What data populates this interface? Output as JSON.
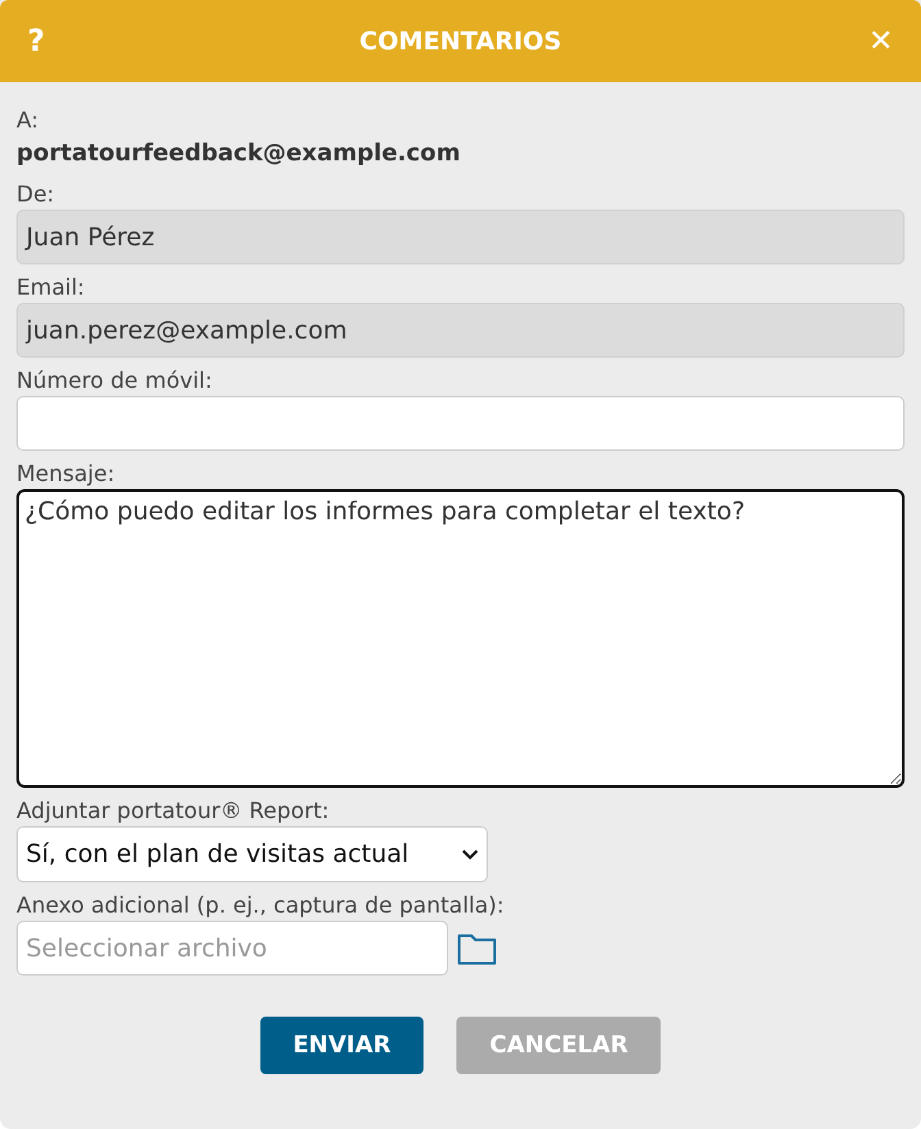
{
  "header": {
    "help": "?",
    "title": "COMENTARIOS",
    "close": "✕"
  },
  "recipient": {
    "label": "A:",
    "value": "portatourfeedback@example.com"
  },
  "fields": [
    {
      "kind": "text",
      "label": "De:",
      "value": "Juan Pérez",
      "disabled": true
    },
    {
      "kind": "text",
      "label": "Email:",
      "value": "juan.perez@example.com",
      "disabled": true
    },
    {
      "kind": "text",
      "label": "Número de móvil:",
      "disabled": false
    },
    {
      "kind": "textarea",
      "label": "Mensaje:",
      "value": "¿Cómo puedo editar los informes para completar el texto?",
      "focused": true
    },
    {
      "kind": "select",
      "label": "Adjuntar portatour® Report:",
      "value": "Sí, con el plan de visitas actual"
    },
    {
      "kind": "file",
      "label": "Anexo adicional (p. ej., captura de pantalla):",
      "placeholder": "Seleccionar archivo"
    }
  ],
  "buttons": [
    {
      "label": "ENVIAR",
      "kind": "primary"
    },
    {
      "label": "CANCELAR",
      "kind": "secondary"
    }
  ]
}
